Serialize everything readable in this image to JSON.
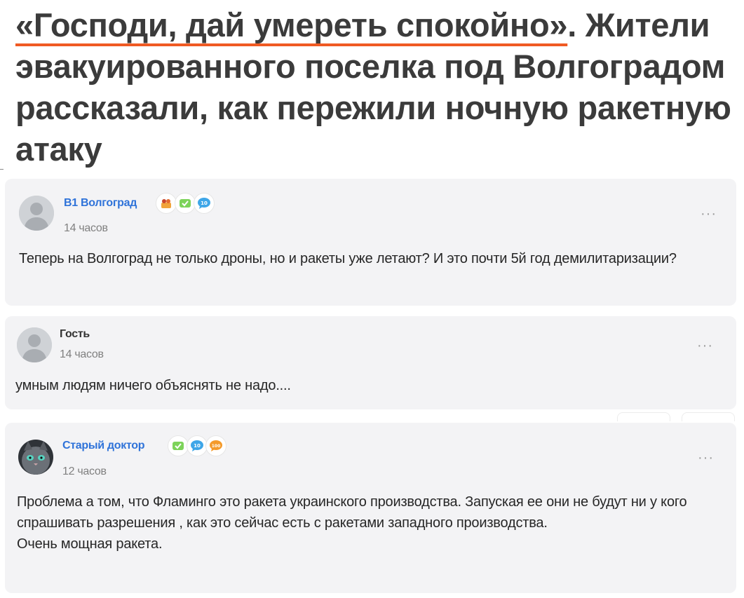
{
  "article": {
    "headline_accent": "«Господи, дай умереть спокойно»",
    "headline_rest": ". Жители эвакуированного поселка под Волгоградом рассказали, как пережили ночную ракетную атаку"
  },
  "comments": [
    {
      "author": "В1 Волгоград",
      "time": "14 часов",
      "text": [
        "Теперь на Волгоград не только дроны, но и ракеты уже летают? И это почти 5й год демилитаризации?"
      ],
      "badges": [
        "group-badge-icon",
        "checkmark-badge-icon",
        "comments-10-badge-icon"
      ],
      "more": "···"
    },
    {
      "author": "Гость",
      "time": "14 часов",
      "text": [
        "умным людям ничего объяснять не надо...."
      ],
      "badges": [],
      "more": "···"
    },
    {
      "author": "Старый доктор",
      "time": "12 часов",
      "text": [
        "Проблема а том, что Фламинго это ракета украинского производства. Запуская ее они не будут ни у кого спрашивать разрешения , как это сейчас есть с ракетами западного производства.",
        "Очень мощная ракета."
      ],
      "badges": [
        "checkmark-badge-icon",
        "comments-10-badge-icon",
        "comments-100-badge-icon"
      ],
      "more": "···"
    }
  ],
  "badge_labels": {
    "ten": "10",
    "hundred": "100"
  },
  "colors": {
    "accent": "#f05a23",
    "link": "#2f73d9",
    "card_bg": "#f3f3f5",
    "muted": "#808080"
  }
}
